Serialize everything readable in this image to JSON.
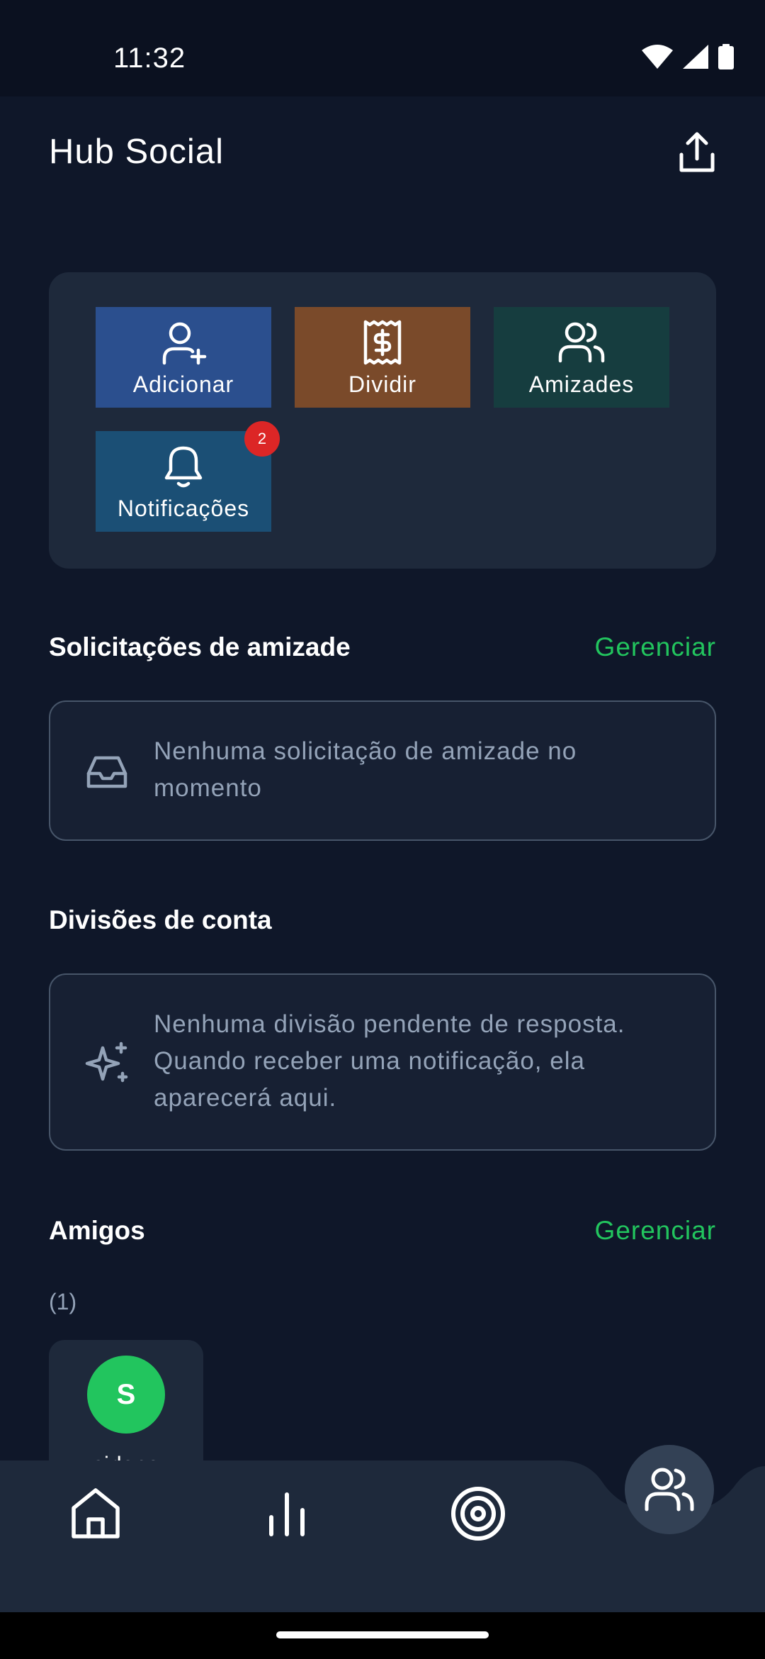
{
  "status_bar": {
    "time": "11:32"
  },
  "header": {
    "title": "Hub Social"
  },
  "actions": {
    "add_label": "Adicionar",
    "split_label": "Dividir",
    "friendships_label": "Amizades",
    "notifications_label": "Notificações",
    "notifications_badge": "2"
  },
  "friend_requests": {
    "title": "Solicitações de amizade",
    "manage_label": "Gerenciar",
    "empty_text": "Nenhuma solicitação de amizade no momento"
  },
  "bill_splits": {
    "title": "Divisões de conta",
    "empty_text": "Nenhuma divisão pendente de resposta. Quando receber uma notificação, ela aparecerá aqui."
  },
  "friends": {
    "title": "Amigos",
    "manage_label": "Gerenciar",
    "count": "(1)",
    "items": [
      {
        "initial": "S",
        "name": "sirlene"
      }
    ]
  },
  "colors": {
    "background": "#0f1729",
    "accent_green": "#22c55e",
    "tile_add": "#2b4f8e",
    "tile_split": "#7a4a2a",
    "tile_friends": "#163d3f",
    "tile_notifications": "#1b4f75",
    "badge_red": "#dc2626"
  },
  "icons": {
    "share": "share-icon",
    "add_user": "user-plus-icon",
    "split": "receipt-dollar-icon",
    "friendships": "users-icon",
    "notifications": "bell-icon",
    "empty_requests": "inbox-icon",
    "empty_splits": "sparkles-icon",
    "nav_home": "home-icon",
    "nav_stats": "bar-chart-icon",
    "nav_goals": "target-icon",
    "nav_social": "users-icon"
  }
}
